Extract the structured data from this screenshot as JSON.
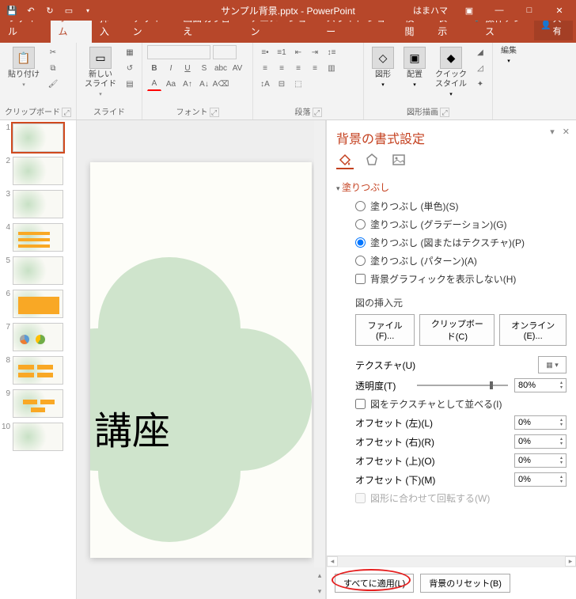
{
  "title": {
    "filename": "サンプル背景.pptx - PowerPoint",
    "user": "はまハマ"
  },
  "tabs": {
    "file": "ファイル",
    "home": "ホーム",
    "insert": "挿入",
    "design": "デザイン",
    "transitions": "画面切り替え",
    "animations": "アニメーション",
    "slideshow": "スライド ショー",
    "review": "校閲",
    "view": "表示",
    "tell_me": "操作アシス",
    "share": "共有"
  },
  "ribbon": {
    "clipboard": {
      "paste": "貼り付け",
      "group": "クリップボード"
    },
    "slides": {
      "new": "新しい\nスライド",
      "group": "スライド"
    },
    "font": {
      "group": "フォント"
    },
    "paragraph": {
      "group": "段落"
    },
    "drawing": {
      "shapes": "図形",
      "arrange": "配置",
      "quick_styles": "クイック\nスタイル",
      "group": "図形描画"
    },
    "editing": {
      "edit": "編集"
    }
  },
  "slide": {
    "text": "講座"
  },
  "thumbnails": {
    "count": 10
  },
  "pane": {
    "title": "背景の書式設定",
    "section_fill": "塗りつぶし",
    "fill_solid": "塗りつぶし (単色)(S)",
    "fill_gradient": "塗りつぶし (グラデーション)(G)",
    "fill_picture": "塗りつぶし (図またはテクスチャ)(P)",
    "fill_pattern": "塗りつぶし (パターン)(A)",
    "hide_bg": "背景グラフィックを表示しない(H)",
    "insert_from": "図の挿入元",
    "btn_file": "ファイル(F)...",
    "btn_clipboard": "クリップボード(C)",
    "btn_online": "オンライン(E)...",
    "texture": "テクスチャ(U)",
    "transparency": "透明度(T)",
    "transparency_val": "80%",
    "tile": "図をテクスチャとして並べる(I)",
    "offset_left": "オフセット (左)(L)",
    "offset_right": "オフセット (右)(R)",
    "offset_top": "オフセット (上)(O)",
    "offset_bottom": "オフセット (下)(M)",
    "offset_left_val": "0%",
    "offset_right_val": "0%",
    "offset_top_val": "0%",
    "offset_bottom_val": "0%",
    "rotate_with_shape": "図形に合わせて回転する(W)",
    "apply_all": "すべてに適用(L)",
    "reset_bg": "背景のリセット(B)"
  }
}
